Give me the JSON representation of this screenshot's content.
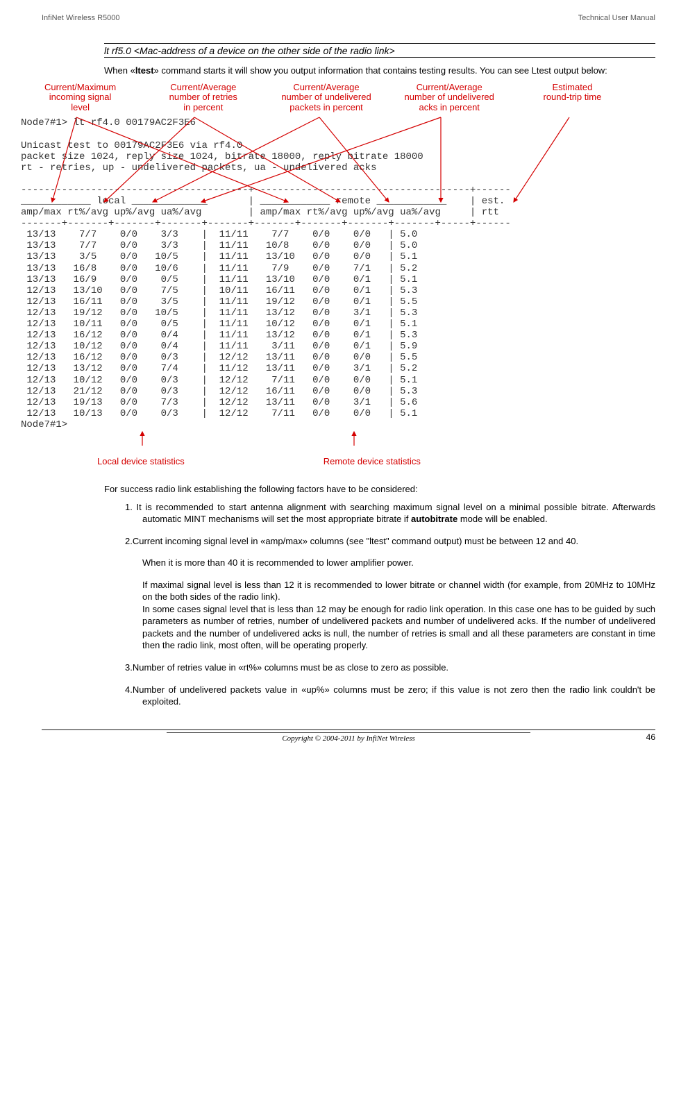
{
  "header": {
    "left": "InfiNet Wireless R5000",
    "right": "Technical User Manual"
  },
  "command_line": "lt rf5.0 <Mac-address of a device on the other side of the radio link>",
  "intro_prefix": "When «",
  "intro_bold": "ltest",
  "intro_suffix": "» command starts it will show you output information that contains testing results. You can see Ltest output below:",
  "labels": {
    "l1a": "Current/Maximum",
    "l1b": "incoming signal",
    "l1c": "level",
    "l2a": "Current/Average",
    "l2b": "number of retries",
    "l2c": "in percent",
    "l3a": "Current/Average",
    "l3b": "number of undelivered",
    "l3c": "packets in percent",
    "l4a": "Current/Average",
    "l4b": "number of undelivered",
    "l4c": "acks in percent",
    "l5a": "Estimated",
    "l5b": "round-trip time"
  },
  "terminal": "Node7#1> lt rf4.0 00179AC2F3E6\n\nUnicast test to 00179AC2F3E6 via rf4.0\npacket size 1024, reply size 1024, bitrate 18000, reply bitrate 18000\nrt - retries, up - undelivered packets, ua - undelivered acks\n\n---------------------------------------+-------------------------------------+------\n____________ local _____________       | ____________ remote ____________    | est.\namp/max rt%/avg up%/avg ua%/avg        | amp/max rt%/avg up%/avg ua%/avg     | rtt\n-------+-------+-------+-------+-------+-------+-------+-------+-------+-----+------\n 13/13    7/7    0/0    3/3    |  11/11    7/7    0/0    0/0   | 5.0\n 13/13    7/7    0/0    3/3    |  11/11   10/8    0/0    0/0   | 5.0\n 13/13    3/5    0/0   10/5    |  11/11   13/10   0/0    0/0   | 5.1\n 13/13   16/8    0/0   10/6    |  11/11    7/9    0/0    7/1   | 5.2\n 13/13   16/9    0/0    0/5    |  11/11   13/10   0/0    0/1   | 5.1\n 12/13   13/10   0/0    7/5    |  10/11   16/11   0/0    0/1   | 5.3\n 12/13   16/11   0/0    3/5    |  11/11   19/12   0/0    0/1   | 5.5\n 12/13   19/12   0/0   10/5    |  11/11   13/12   0/0    3/1   | 5.3\n 12/13   10/11   0/0    0/5    |  11/11   10/12   0/0    0/1   | 5.1\n 12/13   16/12   0/0    0/4    |  11/11   13/12   0/0    0/1   | 5.3\n 12/13   10/12   0/0    0/4    |  11/11    3/11   0/0    0/1   | 5.9\n 12/13   16/12   0/0    0/3    |  12/12   13/11   0/0    0/0   | 5.5\n 12/13   13/12   0/0    7/4    |  11/12   13/11   0/0    3/1   | 5.2\n 12/13   10/12   0/0    0/3    |  12/12    7/11   0/0    0/0   | 5.1\n 12/13   21/12   0/0    0/3    |  12/12   16/11   0/0    0/0   | 5.3\n 12/13   19/13   0/0    7/3    |  12/12   13/11   0/0    3/1   | 5.6\n 12/13   10/13   0/0    0/3    |  12/12    7/11   0/0    0/0   | 5.1\nNode7#1>",
  "bottom_labels": {
    "local": "Local device statistics",
    "remote": "Remote device statistics"
  },
  "section_intro": "For success radio link establishing the following factors have to be considered:",
  "item1_prefix": "1.   It is recommended to start antenna alignment with searching maximum signal level on a minimal possible bitrate.  Afterwards automatic MINT mechanisms will set the most appropriate bitrate if ",
  "item1_bold": "autobitrate",
  "item1_suffix": " mode will be enabled.",
  "item2": "2.Current incoming signal level in «amp/max» columns (see \"ltest\" command output) must be between 12 and 40.",
  "item2_sub1": "When it is more than 40 it is recommended to lower amplifier power.",
  "item2_sub2": "If maximal signal level is less than 12 it is recommended to lower bitrate or channel width (for example, from 20MHz to 10MHz on the both sides of the radio link).",
  "item2_sub3": "In some cases signal level that is less than 12 may be enough for radio link operation. In this case one has to be guided by such parameters as number of retries, number of undelivered packets and number of undelivered acks. If the number of undelivered packets and the number of undelivered acks is null, the number of retries is small and all these parameters are constant in time then the radio link, most often, will be operating properly.",
  "item3": "3.Number of retries value in «rt%» columns must be as close to zero as possible.",
  "item4": "4.Number of undelivered packets value in «up%» columns must be zero; if this value is not zero then the radio link couldn't be exploited.",
  "footer": {
    "copyright": "Copyright © 2004-2011 by InfiNet Wireless",
    "page": "46"
  }
}
